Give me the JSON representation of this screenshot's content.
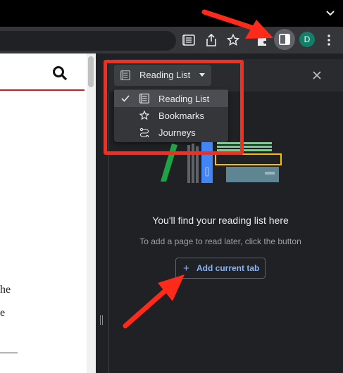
{
  "browser": {
    "avatar_initial": "D",
    "colors": {
      "accent_red": "#ff2a1a",
      "link_blue": "#8ab4f8",
      "avatar_bg": "#137f6a"
    }
  },
  "toolbar": {
    "icons": [
      "reader-mode-icon",
      "share-icon",
      "bookmark-star-icon",
      "extensions-icon",
      "side-panel-icon",
      "menu-dots-icon"
    ]
  },
  "webpage": {
    "text_fragments": [
      "he",
      "e"
    ]
  },
  "side_panel": {
    "selected_view": "Reading List",
    "menu_items": [
      {
        "label": "Reading List",
        "icon": "reading-list-icon",
        "selected": true
      },
      {
        "label": "Bookmarks",
        "icon": "star-icon",
        "selected": false
      },
      {
        "label": "Journeys",
        "icon": "journeys-icon",
        "selected": false
      }
    ],
    "empty_title": "You'll find your reading list here",
    "empty_subtitle": "To add a page to read later, click the button",
    "add_button_label": "Add current tab",
    "add_button_icon": "plus-icon"
  }
}
